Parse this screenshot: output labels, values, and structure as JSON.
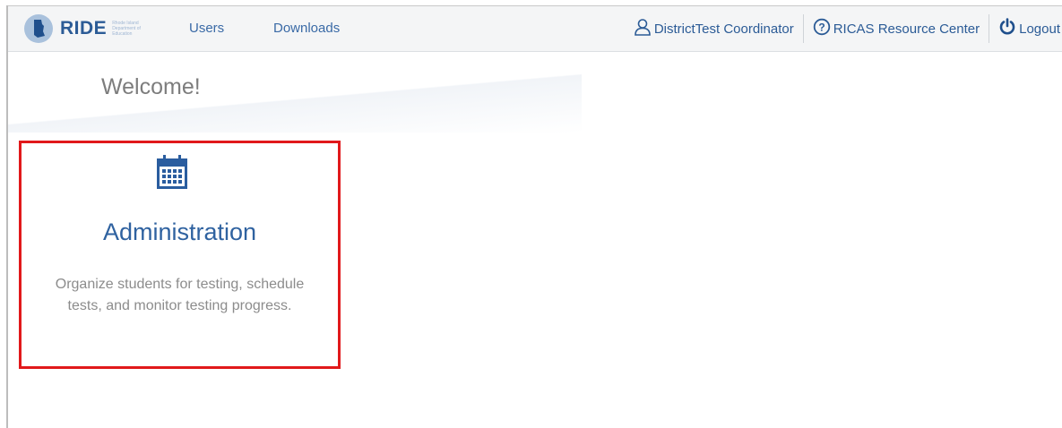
{
  "header": {
    "logo_text": "RIDE",
    "logo_subtext": "Rhode Island Department of Education",
    "nav_links": [
      {
        "label": "Users"
      },
      {
        "label": "Downloads"
      }
    ],
    "user_label": "DistrictTest Coordinator",
    "resource_label": "RICAS Resource Center",
    "logout_label": "Logout"
  },
  "main": {
    "welcome": "Welcome!",
    "cards": [
      {
        "title": "Administration",
        "description": "Organize students for testing, schedule tests, and monitor testing progress.",
        "icon": "calendar-icon"
      }
    ]
  },
  "colors": {
    "accent": "#2b5b96",
    "highlight_border": "#e1191b"
  }
}
